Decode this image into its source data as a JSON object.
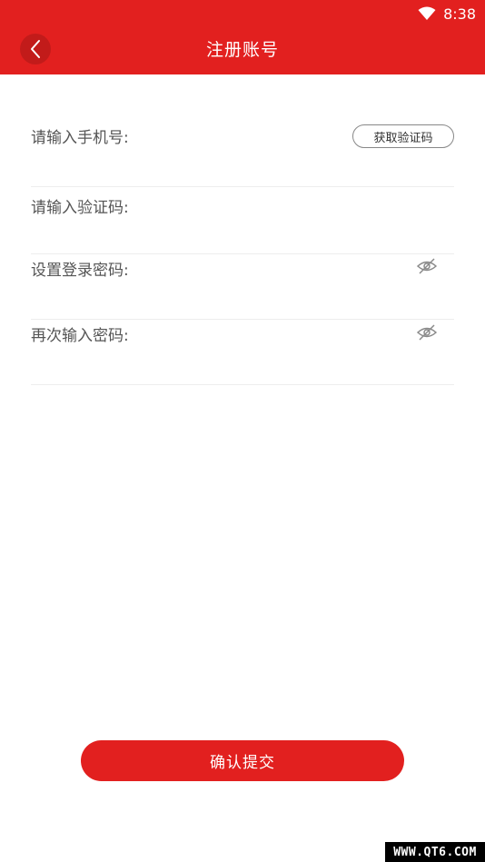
{
  "status_bar": {
    "time": "8:38",
    "wifi_icon": "wifi-icon"
  },
  "header": {
    "title": "注册账号",
    "back_icon": "chevron-left-icon",
    "background_color": "#e2201f"
  },
  "form": {
    "phone": {
      "label": "请输入手机号:",
      "value": "",
      "get_code_label": "获取验证码"
    },
    "code": {
      "label": "请输入验证码:",
      "value": ""
    },
    "password": {
      "label": "设置登录密码:",
      "value": "",
      "visibility_icon": "eye-off-icon"
    },
    "password_confirm": {
      "label": "再次输入密码:",
      "value": "",
      "visibility_icon": "eye-off-icon"
    }
  },
  "submit": {
    "label": "确认提交",
    "color": "#e2201f"
  },
  "watermark": {
    "text": "WWW.QT6.COM"
  }
}
